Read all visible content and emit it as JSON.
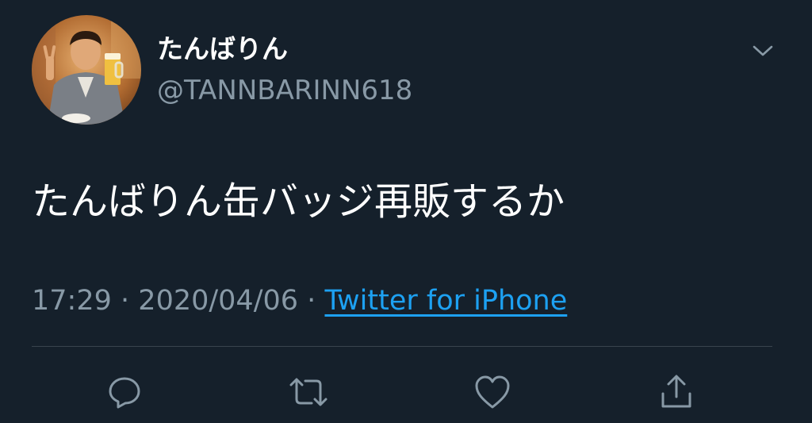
{
  "user": {
    "display_name": "たんばりん",
    "handle": "@TANNBARINN618"
  },
  "tweet": {
    "text": "たんばりん缶バッジ再販するか",
    "time": "17:29",
    "separator": "·",
    "date": "2020/04/06",
    "source": "Twitter for iPhone"
  },
  "icons": {
    "caret": "chevron-down-icon",
    "reply": "reply-icon",
    "retweet": "retweet-icon",
    "like": "heart-icon",
    "share": "share-icon"
  },
  "colors": {
    "background": "#15202b",
    "text": "#ffffff",
    "secondary": "#8899a6",
    "link": "#1da1f2",
    "divider": "#38444d"
  }
}
